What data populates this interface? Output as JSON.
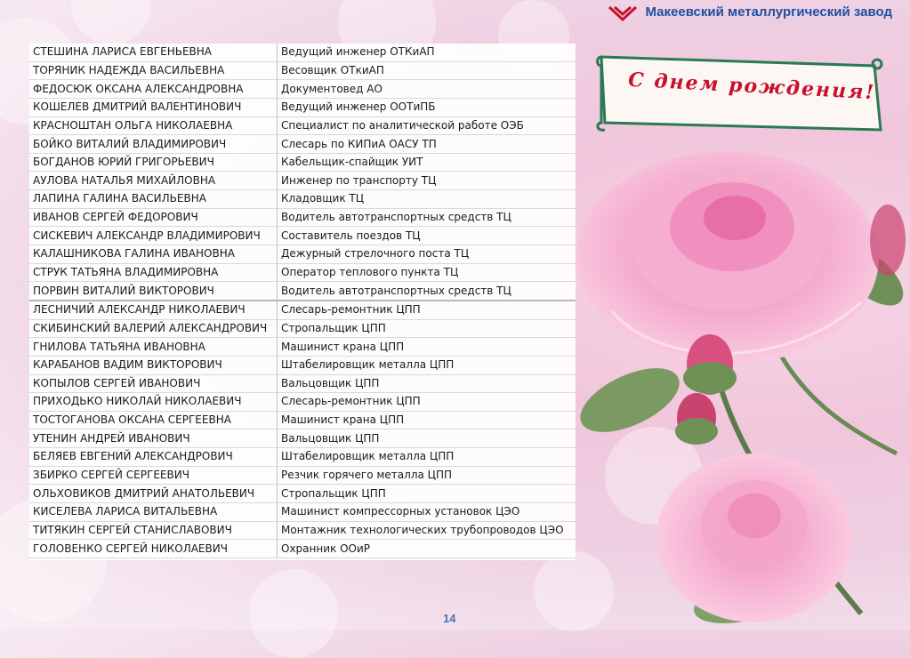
{
  "company": "Макеевский металлургический завод",
  "banner": "С днем рождения!",
  "page_number": "14",
  "employees": [
    {
      "name": "СТЕШИНА ЛАРИСА ЕВГЕНЬЕВНА",
      "position": "Ведущий инженер ОТКиАП"
    },
    {
      "name": "ТОРЯНИК НАДЕЖДА ВАСИЛЬЕВНА",
      "position": "Весовщик ОТкиАП"
    },
    {
      "name": "ФЕДОСЮК ОКСАНА АЛЕКСАНДРОВНА",
      "position": "Документовед АО"
    },
    {
      "name": "КОШЕЛЕВ ДМИТРИЙ ВАЛЕНТИНОВИЧ",
      "position": "Ведущий инженер ООТиПБ"
    },
    {
      "name": "КРАСНОШТАН ОЛЬГА НИКОЛАЕВНА",
      "position": "Специалист по аналитической работе ОЭБ"
    },
    {
      "name": "БОЙКО ВИТАЛИЙ ВЛАДИМИРОВИЧ",
      "position": "Слесарь по КИПиА ОАСУ ТП"
    },
    {
      "name": "БОГДАНОВ ЮРИЙ ГРИГОРЬЕВИЧ",
      "position": "Кабельщик-спайщик УИТ"
    },
    {
      "name": "АУЛОВА НАТАЛЬЯ МИХАЙЛОВНА",
      "position": "Инженер по транспорту ТЦ"
    },
    {
      "name": "ЛАПИНА ГАЛИНА ВАСИЛЬЕВНА",
      "position": "Кладовщик ТЦ"
    },
    {
      "name": "ИВАНОВ СЕРГЕЙ ФЕДОРОВИЧ",
      "position": "Водитель автотранспортных средств ТЦ"
    },
    {
      "name": "СИСКЕВИЧ АЛЕКСАНДР ВЛАДИМИРОВИЧ",
      "position": "Составитель поездов ТЦ"
    },
    {
      "name": "КАЛАШНИКОВА ГАЛИНА ИВАНОВНА",
      "position": "Дежурный стрелочного поста ТЦ"
    },
    {
      "name": "СТРУК ТАТЬЯНА ВЛАДИМИРОВНА",
      "position": "Оператор теплового пункта ТЦ"
    },
    {
      "name": "ПОРВИН ВИТАЛИЙ ВИКТОРОВИЧ",
      "position": "Водитель автотранспортных средств ТЦ"
    },
    {
      "name": "ЛЕСНИЧИЙ АЛЕКСАНДР НИКОЛАЕВИЧ",
      "position": "Слесарь-ремонтник ЦПП"
    },
    {
      "name": "СКИБИНСКИЙ ВАЛЕРИЙ АЛЕКСАНДРОВИЧ",
      "position": "Стропальщик ЦПП"
    },
    {
      "name": "ГНИЛОВА ТАТЬЯНА ИВАНОВНА",
      "position": "Машинист крана ЦПП"
    },
    {
      "name": "КАРАБАНОВ ВАДИМ ВИКТОРОВИЧ",
      "position": "Штабелировщик металла ЦПП"
    },
    {
      "name": "КОПЫЛОВ СЕРГЕЙ ИВАНОВИЧ",
      "position": "Вальцовщик ЦПП"
    },
    {
      "name": "ПРИХОДЬКО НИКОЛАЙ НИКОЛАЕВИЧ",
      "position": "Слесарь-ремонтник ЦПП"
    },
    {
      "name": "ТОСТОГАНОВА ОКСАНА СЕРГЕЕВНА",
      "position": "Машинист крана ЦПП"
    },
    {
      "name": "УТЕНИН АНДРЕЙ ИВАНОВИЧ",
      "position": "Вальцовщик ЦПП"
    },
    {
      "name": "БЕЛЯЕВ ЕВГЕНИЙ АЛЕКСАНДРОВИЧ",
      "position": "Штабелировщик металла ЦПП"
    },
    {
      "name": "ЗБИРКО СЕРГЕЙ СЕРГЕЕВИЧ",
      "position": "Резчик горячего металла ЦПП"
    },
    {
      "name": "ОЛЬХОВИКОВ ДМИТРИЙ АНАТОЛЬЕВИЧ",
      "position": "Стропальщик ЦПП"
    },
    {
      "name": "КИСЕЛЕВА ЛАРИСА ВИТАЛЬЕВНА",
      "position": "Машинист компрессорных установок ЦЭО"
    },
    {
      "name": "ТИТЯКИН СЕРГЕЙ СТАНИСЛАВОВИЧ",
      "position": "Монтажник технологических трубопроводов ЦЭО"
    },
    {
      "name": "ГОЛОВЕНКО СЕРГЕЙ НИКОЛАЕВИЧ",
      "position": "Охранник ООиР"
    }
  ]
}
